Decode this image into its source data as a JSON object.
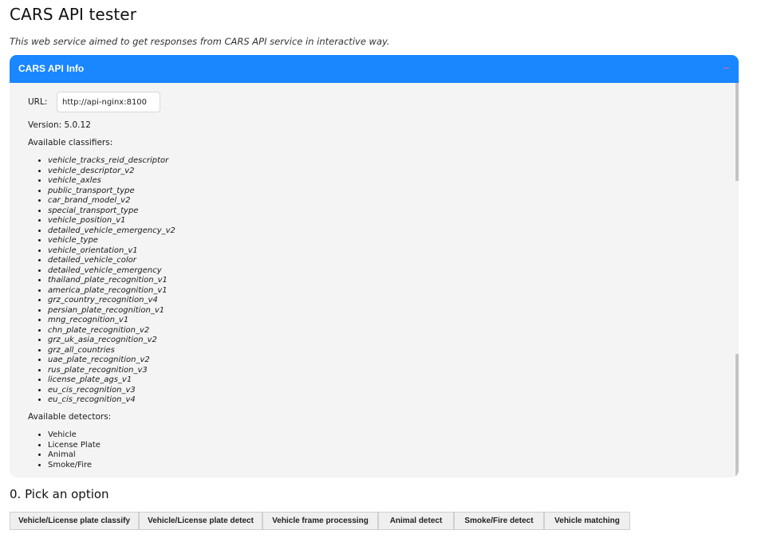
{
  "page": {
    "title": "CARS API tester",
    "subtitle": "This web service aimed to get responses from CARS API service in interactive way."
  },
  "info_panel": {
    "title": "CARS API Info",
    "collapse_icon": "minus-icon",
    "url_label": "URL:",
    "url_value": "http://api-nginx:8100",
    "version": "Version: 5.0.12",
    "classifiers_title": "Available classifiers:",
    "classifiers": [
      "vehicle_tracks_reid_descriptor",
      "vehicle_descriptor_v2",
      "vehicle_axles",
      "public_transport_type",
      "car_brand_model_v2",
      "special_transport_type",
      "vehicle_position_v1",
      "detailed_vehicle_emergency_v2",
      "vehicle_type",
      "vehicle_orientation_v1",
      "detailed_vehicle_color",
      "detailed_vehicle_emergency",
      "thailand_plate_recognition_v1",
      "america_plate_recognition_v1",
      "grz_country_recognition_v4",
      "persian_plate_recognition_v1",
      "mng_recognition_v1",
      "chn_plate_recognition_v2",
      "grz_uk_asia_recognition_v2",
      "grz_all_countries",
      "uae_plate_recognition_v2",
      "rus_plate_recognition_v3",
      "license_plate_ags_v1",
      "eu_cis_recognition_v3",
      "eu_cis_recognition_v4"
    ],
    "detectors_title": "Available detectors:",
    "detectors": [
      "Vehicle",
      "License Plate",
      "Animal",
      "Smoke/Fire"
    ]
  },
  "options_section": {
    "title": "0. Pick an option",
    "buttons": [
      "Vehicle/License plate classify",
      "Vehicle/License plate detect",
      "Vehicle frame processing",
      "Animal detect",
      "Smoke/Fire detect",
      "Vehicle matching"
    ]
  },
  "colors": {
    "header_blue": "#1a86ff",
    "panel_bg": "#f4f4f4",
    "button_bg": "#efefef"
  }
}
